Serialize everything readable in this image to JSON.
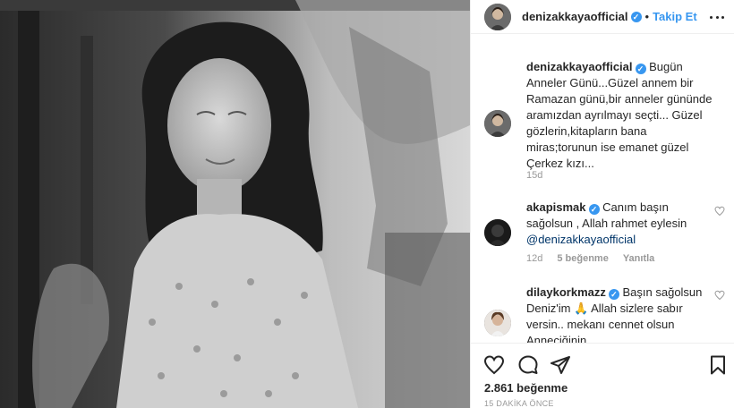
{
  "post": {
    "username": "denizakkayaofficial",
    "follow_label": "Takip Et",
    "separator": "•",
    "likes": "2.861 beğenme",
    "timestamp": "15 DAKİKA ÖNCE"
  },
  "caption": {
    "username": "denizakkayaofficial",
    "text": "Bugün Anneler Günü...Güzel annem bir Ramazan günü,bir anneler gününde aramızdan ayrılmayı seçti... Güzel gözlerin,kitapların bana miras;torunun ise emanet güzel Çerkez kızı...",
    "time": "15d"
  },
  "comments": [
    {
      "username": "akapismak",
      "text": "Canım başın sağolsun , Allah rahmet eylesin",
      "mention": "@denizakkayaofficial",
      "time": "12d",
      "likes": "5 beğenme",
      "reply": "Yanıtla"
    },
    {
      "username": "dilaykorkmazz",
      "text": "Başın sağolsun Deniz'im 🙏 Allah sizlere sabır versin.. mekanı cennet olsun Anneciğinin.."
    }
  ],
  "icons": [
    "verified-icon",
    "more-options-icon",
    "heart-icon",
    "comment-icon",
    "share-icon",
    "bookmark-icon"
  ],
  "colors": {
    "accent": "#3897f0",
    "verified": "#3897f0",
    "text": "#262626",
    "muted": "#999999",
    "border": "#efefef"
  }
}
